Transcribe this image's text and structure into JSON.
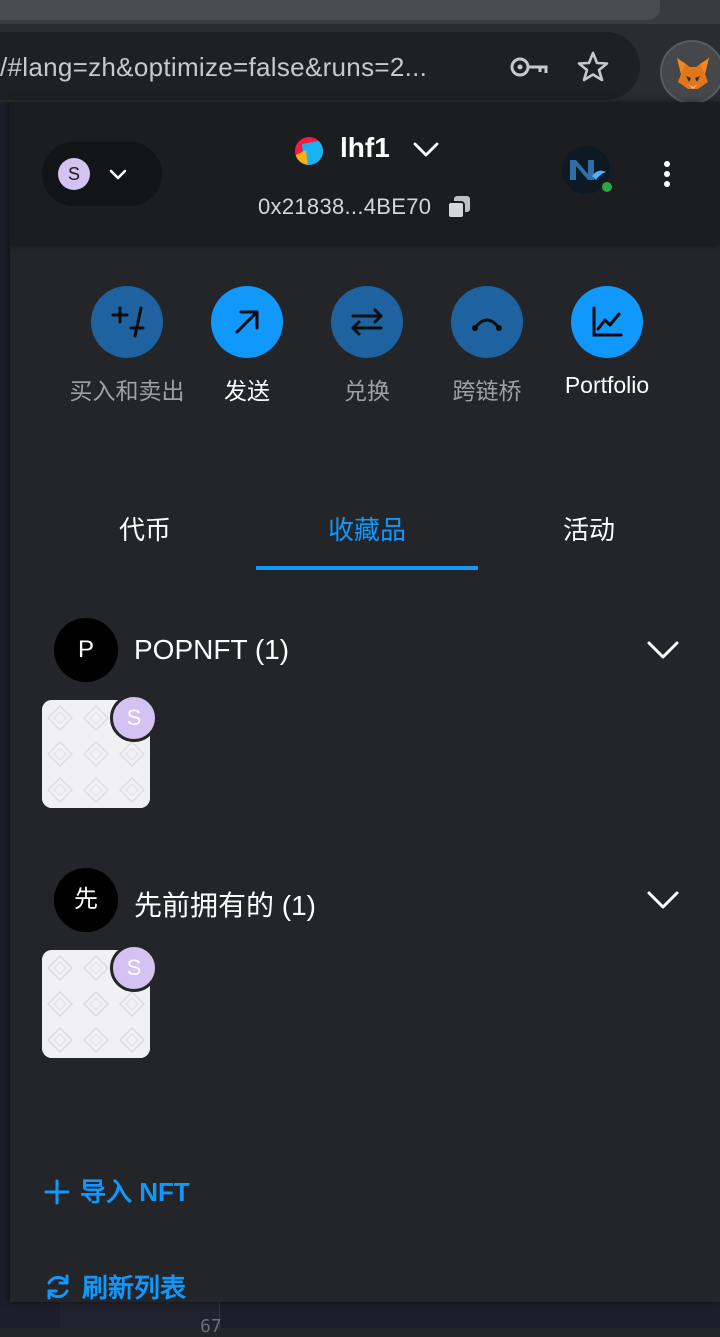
{
  "browser": {
    "url_text": "/#lang=zh&optimize=false&runs=2..."
  },
  "header": {
    "network_letter": "S",
    "account_name": "lhf1",
    "account_address": "0x21838...4BE70"
  },
  "actions": [
    {
      "label": "买入和卖出",
      "icon": "plus-minus-icon",
      "active": false
    },
    {
      "label": "发送",
      "icon": "arrow-up-right-icon",
      "active": true
    },
    {
      "label": "兑换",
      "icon": "swap-arrows-icon",
      "active": false
    },
    {
      "label": "跨链桥",
      "icon": "bridge-icon",
      "active": false
    },
    {
      "label": "Portfolio",
      "icon": "chart-line-icon",
      "active": true
    }
  ],
  "tabs": [
    {
      "label": "代币"
    },
    {
      "label": "收藏品",
      "active": true
    },
    {
      "label": "活动"
    }
  ],
  "collections": [
    {
      "avatar_letter": "P",
      "title": "POPNFT (1)",
      "badge_letter": "S"
    },
    {
      "avatar_letter": "先",
      "title": "先前拥有的 (1)",
      "badge_letter": "S"
    }
  ],
  "links": {
    "import_nft": "导入 NFT",
    "refresh_list": "刷新列表"
  },
  "editor": {
    "line_number": "67"
  },
  "colors": {
    "accent": "#1098fc",
    "action_dim": "#1e63a0",
    "background": "#232528",
    "header_bg": "#1c1d20",
    "badge": "#d4c2f2",
    "online": "#28a745"
  }
}
